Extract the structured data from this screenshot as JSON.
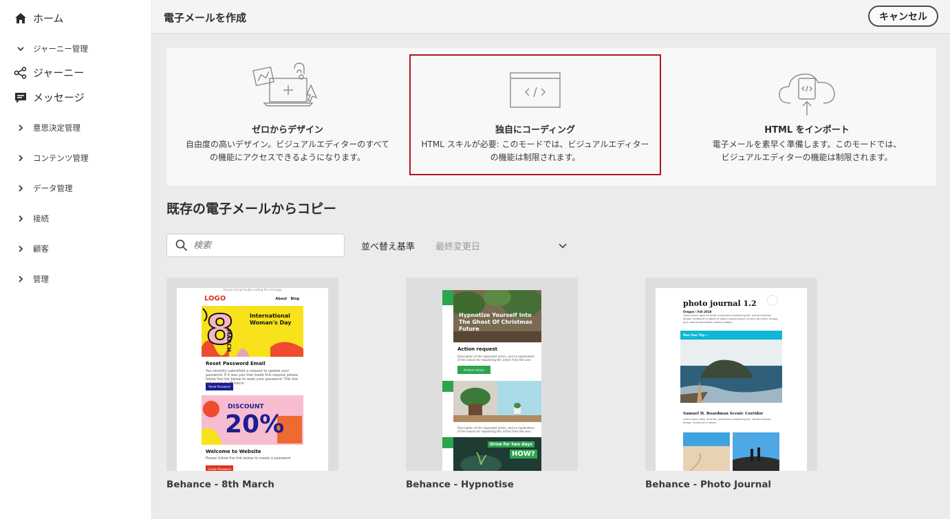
{
  "sidebar": {
    "items": [
      {
        "label": "ホーム",
        "icon": "home-icon"
      },
      {
        "label": "ジャーニー管理",
        "icon": "chevron-down-icon"
      },
      {
        "label": "ジャーニー",
        "icon": "journey-icon"
      },
      {
        "label": "メッセージ",
        "icon": "message-icon"
      },
      {
        "label": "意思決定管理",
        "icon": "chevron-right-icon"
      },
      {
        "label": "コンテンツ管理",
        "icon": "chevron-right-icon"
      },
      {
        "label": "データ管理",
        "icon": "chevron-right-icon"
      },
      {
        "label": "接続",
        "icon": "chevron-right-icon"
      },
      {
        "label": "顧客",
        "icon": "chevron-right-icon"
      },
      {
        "label": "管理",
        "icon": "chevron-right-icon"
      }
    ]
  },
  "header": {
    "title": "電子メールを作成",
    "cancel_label": "キャンセル"
  },
  "options": [
    {
      "title": "ゼロからデザイン",
      "desc1": "自由度の高いデザイン。ビジュアルエディターのすべて",
      "desc2": "の機能にアクセスできるようになります。"
    },
    {
      "title": "独自にコーディング",
      "desc1": "HTML スキルが必要: このモードでは、ビジュアルエディター",
      "desc2": "の機能は制限されます。"
    },
    {
      "title": "HTML をインポート",
      "desc1": "電子メールを素早く準備します。このモードでは、",
      "desc2": "ビジュアルエディターの機能は制限されます。"
    }
  ],
  "copy_section": {
    "title": "既存の電子メールからコピー",
    "search_placeholder": "検索",
    "sort_label": "並べ替え基準",
    "sort_value": "最終変更日"
  },
  "templates": [
    {
      "name": "Behance - 8th March",
      "preheader": "Ensure trying trouble visiting the message",
      "logo": "LOGO",
      "nav": [
        "About",
        "Blog"
      ],
      "hero_number": "8",
      "hero_vertical": "MARCH",
      "hero_text": "International Woman's Day",
      "section1_title": "Reset Password Email",
      "section1_body": "You recently submitted a request to update your password. If it was you that made this request please follow the link below to reset your password. This link will expire in 48 hours.",
      "section1_button": "Reset Password",
      "promo_label": "DISCOUNT",
      "promo_value": "20%",
      "section2_title": "Welcome to Website",
      "section2_body": "Please follow the link below to create a password",
      "section2_button": "Create Password"
    },
    {
      "name": "Behance - Hypnotise",
      "hero_text": "Hypnotize Yourself Into The Ghost Of Christmas Future",
      "action_title": "Action request",
      "action_body": "Description of the requested action, and an explanation of the reason for requesting this action from the user.",
      "action_button": "Perform Action",
      "section2_body": "Description of the requested action, and an explanation of the reason for requesting this action from the user.",
      "banner_text": "Grow for two days",
      "banner_big": "HOW?"
    },
    {
      "name": "Behance - Photo Journal",
      "masthead": "photo journal 1.2",
      "issue": "Oregon \\ Fall 2018",
      "intro": "Lorem ipsum dolor sit amet, consectetur adipisicing elit, sed do eiusmod tempor incididunt ut labore et dolore magna aliqua. Ut enim ad minim veniam, quis nostrud exercitation ullamco laboris.",
      "bar_text": "Plan Your Trip →",
      "article_title": "Samuel H. Boardman Scenic Corridor",
      "article_body": "Lorem ipsum dolor sit amet, consectetur adipisicing elit, sed do eiusmod tempor incididunt ut labore."
    }
  ],
  "colors": {
    "selected_border": "#b3141c",
    "main_bg": "#ebebeb",
    "accent_green": "#2da44e",
    "accent_cyan": "#0fb6d6"
  }
}
